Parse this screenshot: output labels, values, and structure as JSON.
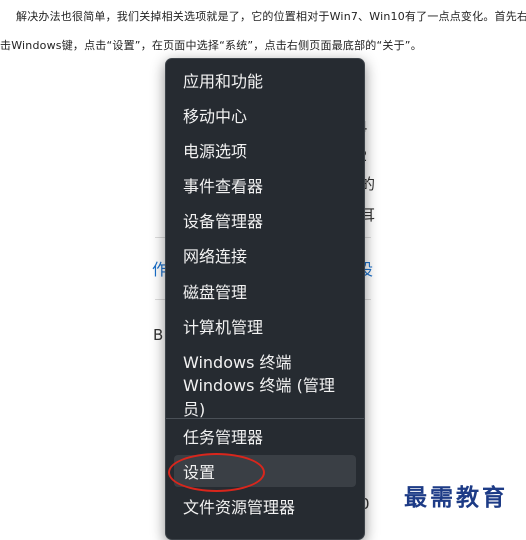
{
  "article": {
    "line1": "解决办法也很简单，我们关掉相关选项就是了，它的位置相对于Win7、Win10有了一点点变化。首先右键点",
    "line2": "击Windows键，点击“设置”，在页面中选择“系统”，点击右侧页面最底部的“关于”。"
  },
  "background_fragments": {
    "f1": "4",
    "f2": "2",
    "f3": "的",
    "f4": "耳",
    "f5": "作",
    "f6": "设",
    "f7": "B",
    "f8": "0"
  },
  "context_menu": {
    "items": [
      "应用和功能",
      "移动中心",
      "电源选项",
      "事件查看器",
      "设备管理器",
      "网络连接",
      "磁盘管理",
      "计算机管理",
      "Windows 终端",
      "Windows 终端 (管理员)",
      "任务管理器",
      "设置",
      "文件资源管理器"
    ]
  },
  "watermark": "最需教育",
  "colors": {
    "menu_background": "#262b31",
    "highlight_circle": "#d9261c",
    "watermark": "#1d3b86"
  }
}
